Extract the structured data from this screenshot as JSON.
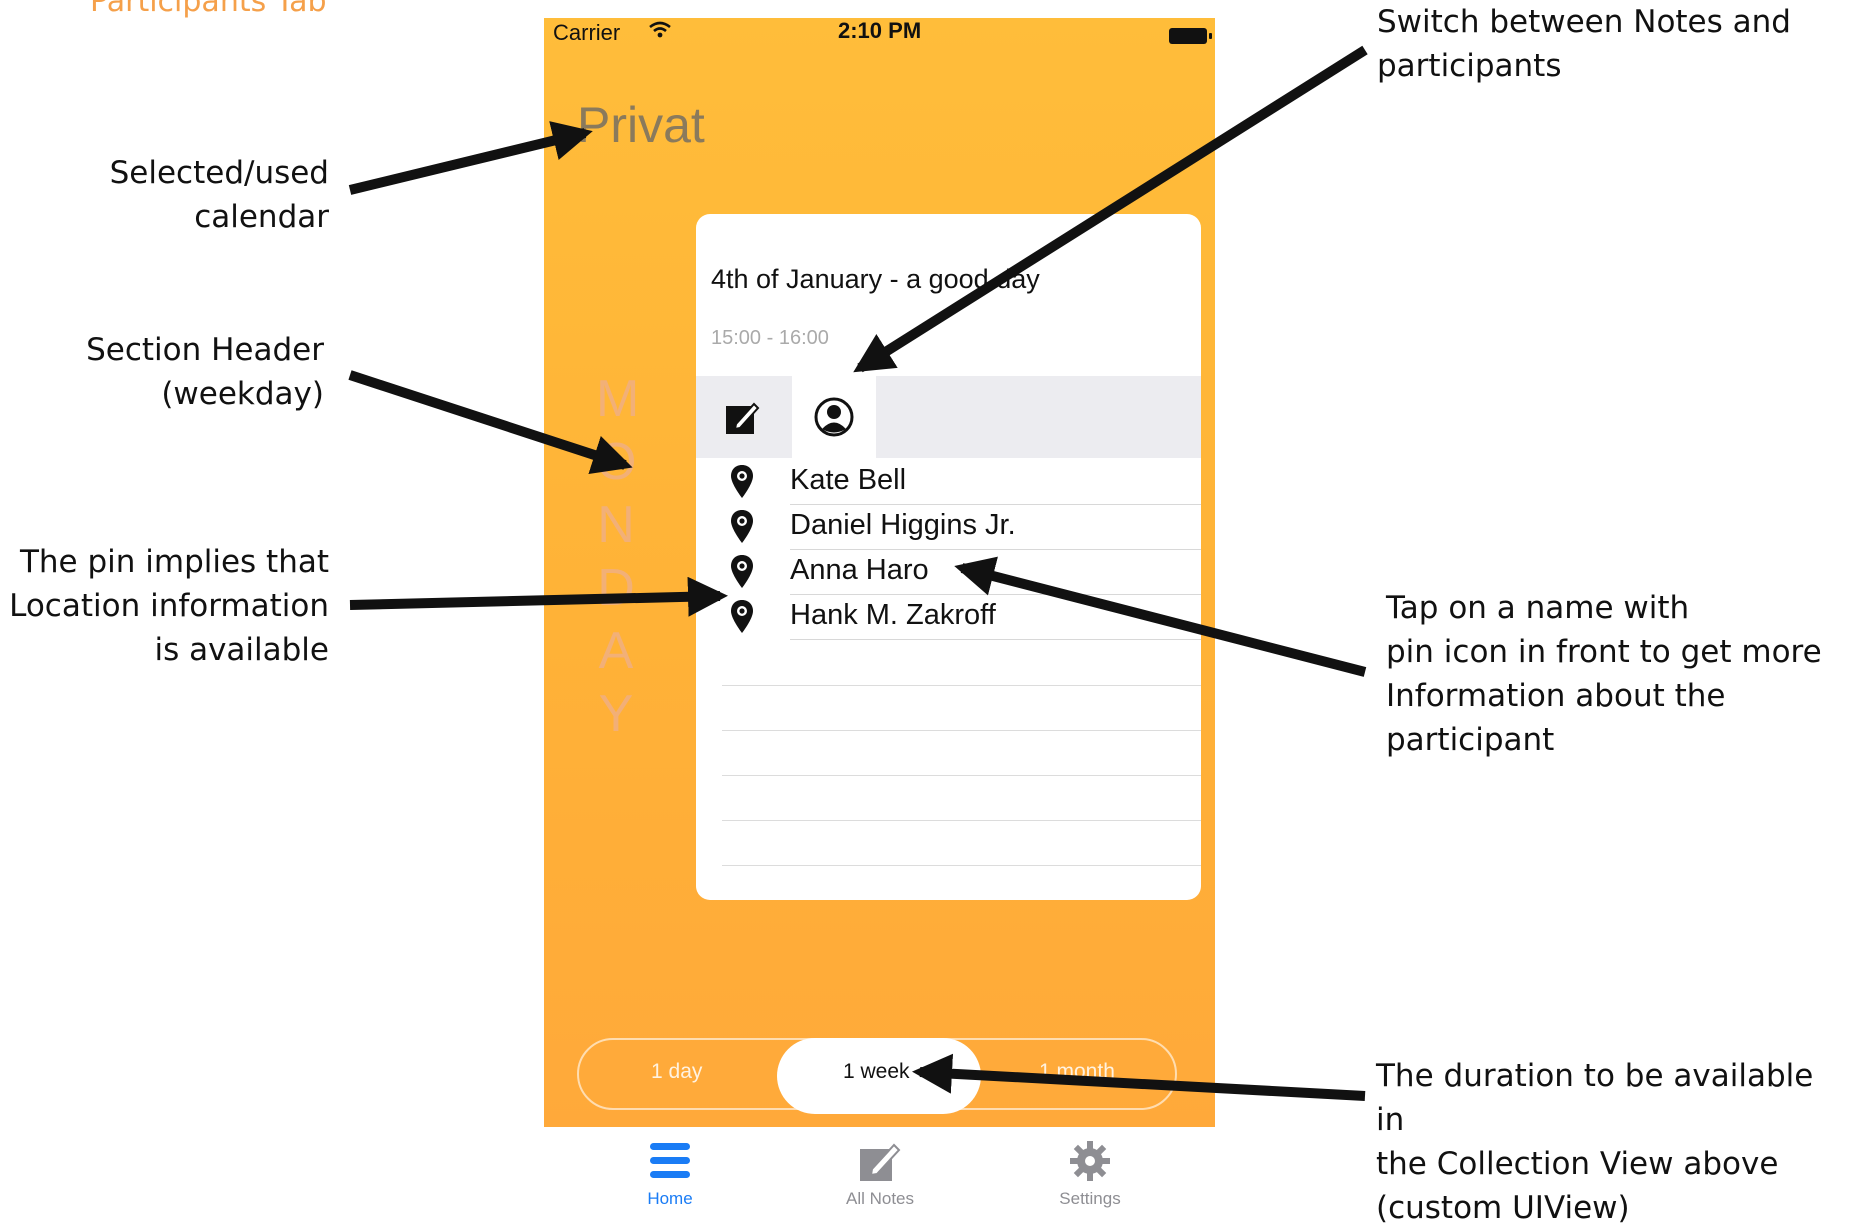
{
  "page_heading": "Participants Tab",
  "status_bar": {
    "carrier": "Carrier",
    "time": "2:10 PM"
  },
  "calendar_title": "Privat",
  "weekday_letters": [
    "M",
    "O",
    "N",
    "D",
    "A",
    "Y"
  ],
  "event": {
    "title": "4th of January - a good day",
    "time": "15:00 - 16:00"
  },
  "participants": [
    {
      "name": "Kate Bell"
    },
    {
      "name": "Daniel Higgins Jr."
    },
    {
      "name": "Anna Haro"
    },
    {
      "name": "Hank M. Zakroff"
    }
  ],
  "duration_options": [
    "1 day",
    "1 week",
    "1 month"
  ],
  "duration_selected": "1 week",
  "bottom_tabs": [
    {
      "label": "Home",
      "icon": "menu-icon",
      "active": true
    },
    {
      "label": "All Notes",
      "icon": "note-edit-icon",
      "active": false
    },
    {
      "label": "Settings",
      "icon": "gear-icon",
      "active": false
    }
  ],
  "colors": {
    "accent_orange": "#ffb237",
    "tab_active_blue": "#1a7cf5",
    "heading_orange": "#f5a04a"
  },
  "annotations": {
    "calendar": [
      "Selected/used",
      "calendar"
    ],
    "section_header": [
      "Section Header",
      "(weekday)"
    ],
    "pin": [
      "The pin implies that",
      "Location information",
      "is available"
    ],
    "switch": [
      "Switch between Notes and",
      "participants"
    ],
    "tap_name": [
      "Tap on a name with",
      "pin icon in front to get more",
      "Information about the",
      "participant"
    ],
    "duration": [
      "The duration to be available in",
      "the Collection View above",
      "(custom UIView)"
    ]
  }
}
